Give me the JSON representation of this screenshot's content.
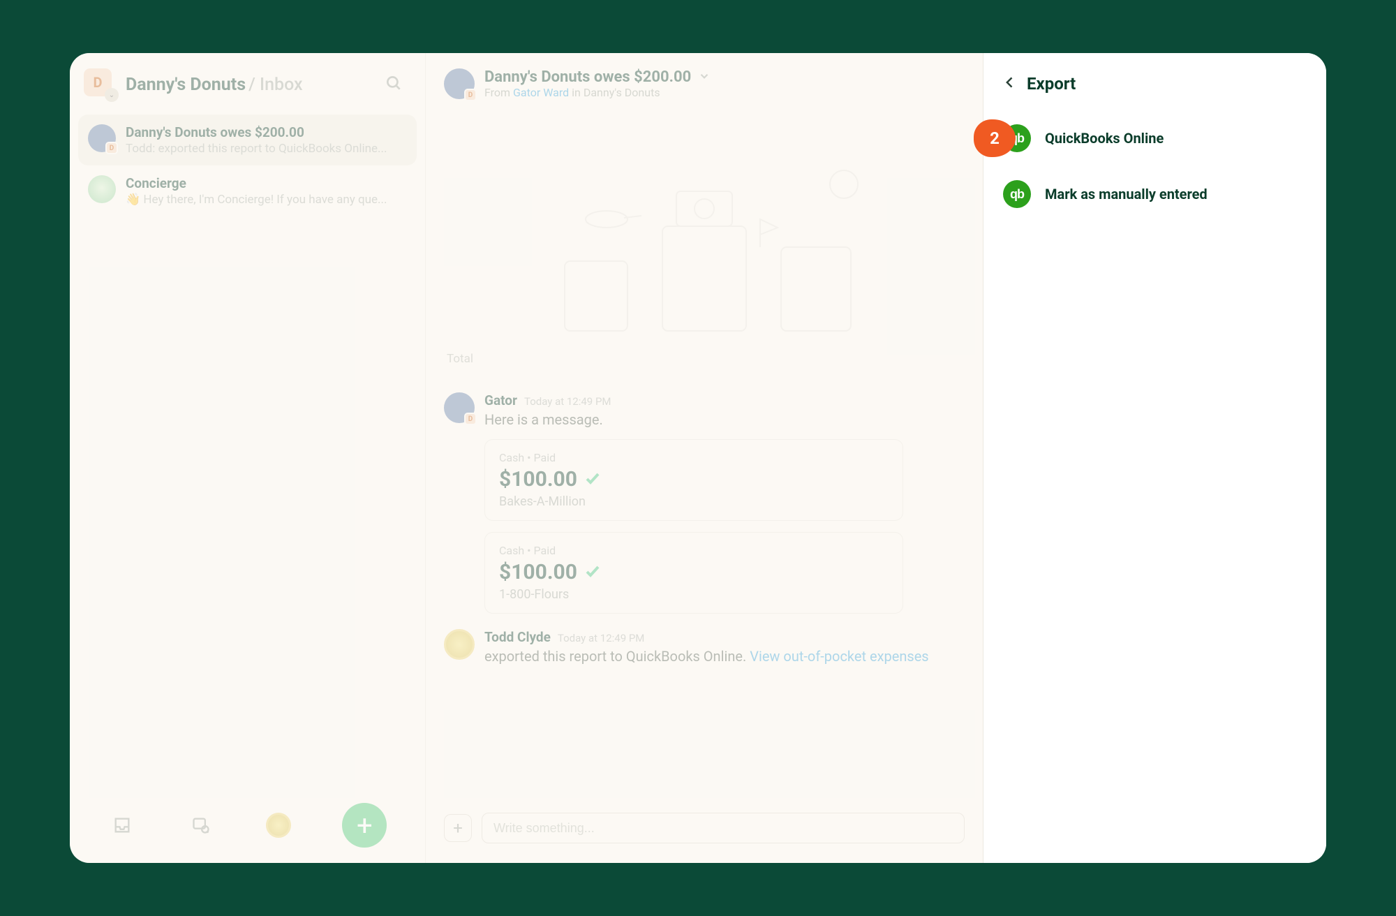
{
  "sidebar": {
    "workspace": {
      "letter": "D",
      "name": "Danny's Donuts",
      "crumb": "Inbox"
    },
    "chats": [
      {
        "title": "Danny's Donuts owes $200.00",
        "preview": "Todd: exported this report to QuickBooks Online...",
        "mini": "D",
        "selected": true
      },
      {
        "title": "Concierge",
        "preview": "👋 Hey there, I'm Concierge! If you have any que...",
        "concierge": true
      }
    ]
  },
  "main": {
    "title": "Danny's Donuts owes $200.00",
    "from_prefix": "From",
    "from_name": "Gator Ward",
    "from_suffix": "in Danny's Donuts",
    "total_label": "Total",
    "messages": {
      "gator": {
        "name": "Gator",
        "time": "Today at 12:49 PM",
        "body": "Here is a message."
      },
      "expenses": [
        {
          "meta": "Cash • Paid",
          "amount": "$100.00",
          "vendor": "Bakes-A-Million"
        },
        {
          "meta": "Cash • Paid",
          "amount": "$100.00",
          "vendor": "1-800-Flours"
        }
      ],
      "todd": {
        "name": "Todd Clyde",
        "time": "Today at 12:49 PM",
        "body": "exported this report to QuickBooks Online.",
        "link": "View out-of-pocket expenses"
      }
    },
    "composer_placeholder": "Write something..."
  },
  "panel": {
    "title": "Export",
    "items": [
      {
        "label": "QuickBooks Online",
        "step": "2"
      },
      {
        "label": "Mark as manually entered"
      }
    ]
  }
}
